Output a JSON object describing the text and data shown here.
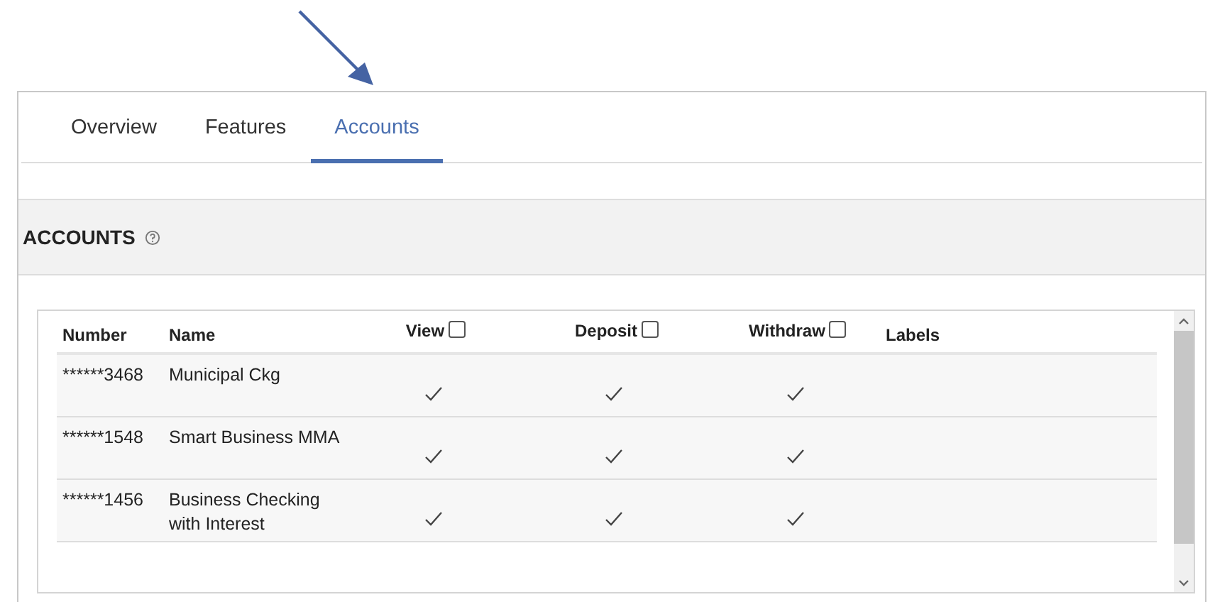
{
  "tabs": [
    {
      "label": "Overview",
      "selected": false
    },
    {
      "label": "Features",
      "selected": false
    },
    {
      "label": "Accounts",
      "selected": true
    }
  ],
  "section": {
    "title": "ACCOUNTS"
  },
  "table": {
    "columns": [
      {
        "label": "Number",
        "kind": "text"
      },
      {
        "label": "Name",
        "kind": "text"
      },
      {
        "label": "View",
        "kind": "check",
        "checked": false
      },
      {
        "label": "Deposit",
        "kind": "check",
        "checked": false
      },
      {
        "label": "Withdraw",
        "kind": "check",
        "checked": false
      },
      {
        "label": "Labels",
        "kind": "text"
      }
    ],
    "rows": [
      {
        "number": "******3468",
        "name": "Municipal Ckg",
        "view": true,
        "deposit": true,
        "withdraw": true
      },
      {
        "number": "******1548",
        "name": "Smart Business MMA",
        "view": true,
        "deposit": true,
        "withdraw": true
      },
      {
        "number": "******1456",
        "name": "Business Checking with Interest",
        "view": true,
        "deposit": true,
        "withdraw": true
      }
    ]
  }
}
